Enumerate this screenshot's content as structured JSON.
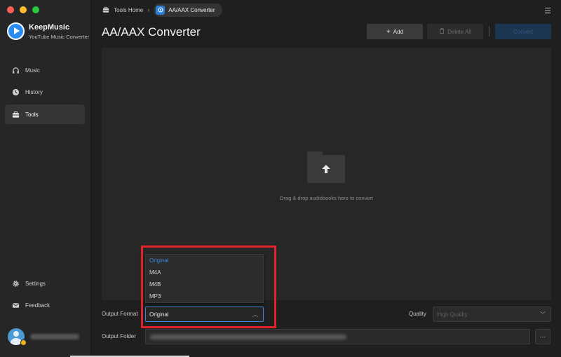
{
  "app": {
    "name": "KeepMusic",
    "subtitle": "YouTube Music Converter"
  },
  "sidebar": {
    "items": [
      {
        "label": "Music",
        "icon": "headphones-icon"
      },
      {
        "label": "History",
        "icon": "clock-icon"
      },
      {
        "label": "Tools",
        "icon": "toolbox-icon",
        "active": true
      }
    ],
    "bottom_items": [
      {
        "label": "Settings",
        "icon": "gear-icon"
      },
      {
        "label": "Feedback",
        "icon": "mail-icon"
      }
    ]
  },
  "breadcrumb": {
    "home": "Tools Home",
    "current": "AA/AAX Converter"
  },
  "page": {
    "title": "AA/AAX Converter"
  },
  "toolbar": {
    "add_label": "Add",
    "delete_label": "Delete All",
    "convert_label": "Convert"
  },
  "dropzone": {
    "text": "Drag & drop audiobooks here to convert"
  },
  "output": {
    "format_label": "Output Format",
    "format_value": "Original",
    "format_options": [
      "Original",
      "M4A",
      "M4B",
      "MP3"
    ],
    "quality_label": "Quality",
    "quality_value": "High Quality",
    "folder_label": "Output Folder",
    "more_label": "···"
  },
  "colors": {
    "accent": "#3f86d8",
    "highlight": "#e0232b"
  }
}
